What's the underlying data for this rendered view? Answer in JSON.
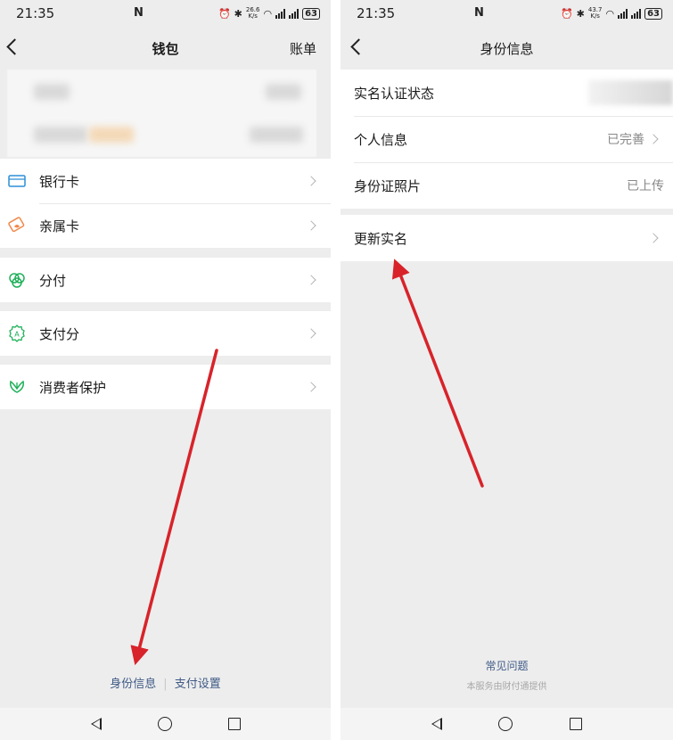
{
  "status_bar": {
    "time": "21:35",
    "battery": "63",
    "left_speed": [
      "26.6",
      "K/s"
    ],
    "right_speed": [
      "43.7",
      "K/s"
    ]
  },
  "wallet_screen": {
    "title": "钱包",
    "bill_link": "账单",
    "menu_groups": [
      [
        {
          "label": "银行卡",
          "icon": "bank-card-icon"
        },
        {
          "label": "亲属卡",
          "icon": "family-card-icon"
        }
      ],
      [
        {
          "label": "分付",
          "icon": "installment-icon"
        }
      ],
      [
        {
          "label": "支付分",
          "icon": "pay-score-icon"
        }
      ],
      [
        {
          "label": "消费者保护",
          "icon": "consumer-protection-icon"
        }
      ]
    ],
    "footer": {
      "identity_link": "身份信息",
      "pay_settings_link": "支付设置"
    }
  },
  "identity_screen": {
    "title": "身份信息",
    "rows": [
      {
        "label": "实名认证状态",
        "value": ""
      },
      {
        "label": "个人信息",
        "value": "已完善"
      },
      {
        "label": "身份证照片",
        "value": "已上传"
      }
    ],
    "update_row": {
      "label": "更新实名"
    },
    "footer": {
      "faq": "常见问题",
      "provider_note": "本服务由财付通提供"
    }
  },
  "colors": {
    "accent_link": "#3f5a86",
    "annotation_arrow": "#d8232a",
    "bank_icon": "#2b8fd6",
    "family_icon": "#f0894a",
    "green_icon": "#20b05a"
  }
}
